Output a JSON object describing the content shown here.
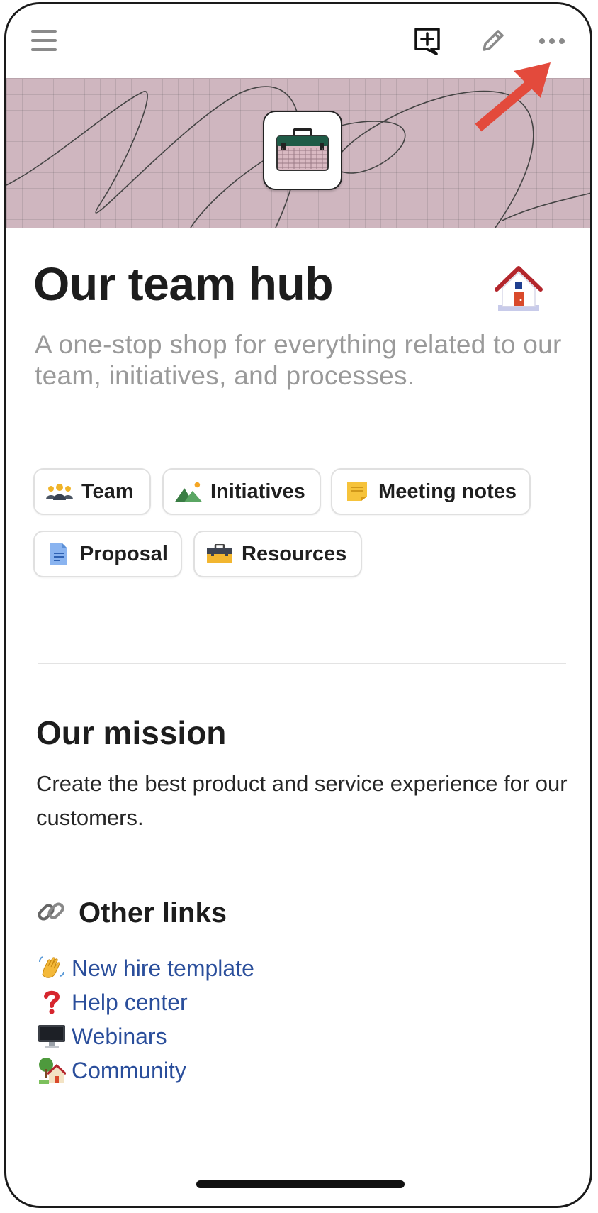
{
  "topbar": {
    "menu_icon": "hamburger-menu-icon",
    "comment_icon": "add-comment-icon",
    "edit_icon": "pencil-icon",
    "more_icon": "more-horizontal-icon"
  },
  "cover": {
    "background_color": "#cfb6bf",
    "page_icon": "toolbox-icon",
    "annotation_arrow_color": "#e34a3c"
  },
  "page": {
    "title": "Our team hub",
    "title_icon": "house-icon",
    "subtitle": "A one-stop shop for everything related to our team, initiatives, and processes."
  },
  "chips": [
    {
      "label": "Team",
      "icon": "people-icon"
    },
    {
      "label": "Initiatives",
      "icon": "mountain-icon"
    },
    {
      "label": "Meeting notes",
      "icon": "sticky-note-icon"
    },
    {
      "label": "Proposal",
      "icon": "document-icon"
    },
    {
      "label": "Resources",
      "icon": "toolbox-icon"
    }
  ],
  "mission": {
    "heading": "Our mission",
    "body": "Create the best product and service experience for our customers."
  },
  "other_links": {
    "heading": "Other links",
    "heading_icon": "link-icon",
    "items": [
      {
        "label": "New hire template",
        "icon": "waving-hand-icon"
      },
      {
        "label": "Help center",
        "icon": "question-mark-icon"
      },
      {
        "label": "Webinars",
        "icon": "desktop-computer-icon"
      },
      {
        "label": "Community",
        "icon": "house-with-garden-icon"
      }
    ],
    "link_color": "#2a4e9b"
  }
}
